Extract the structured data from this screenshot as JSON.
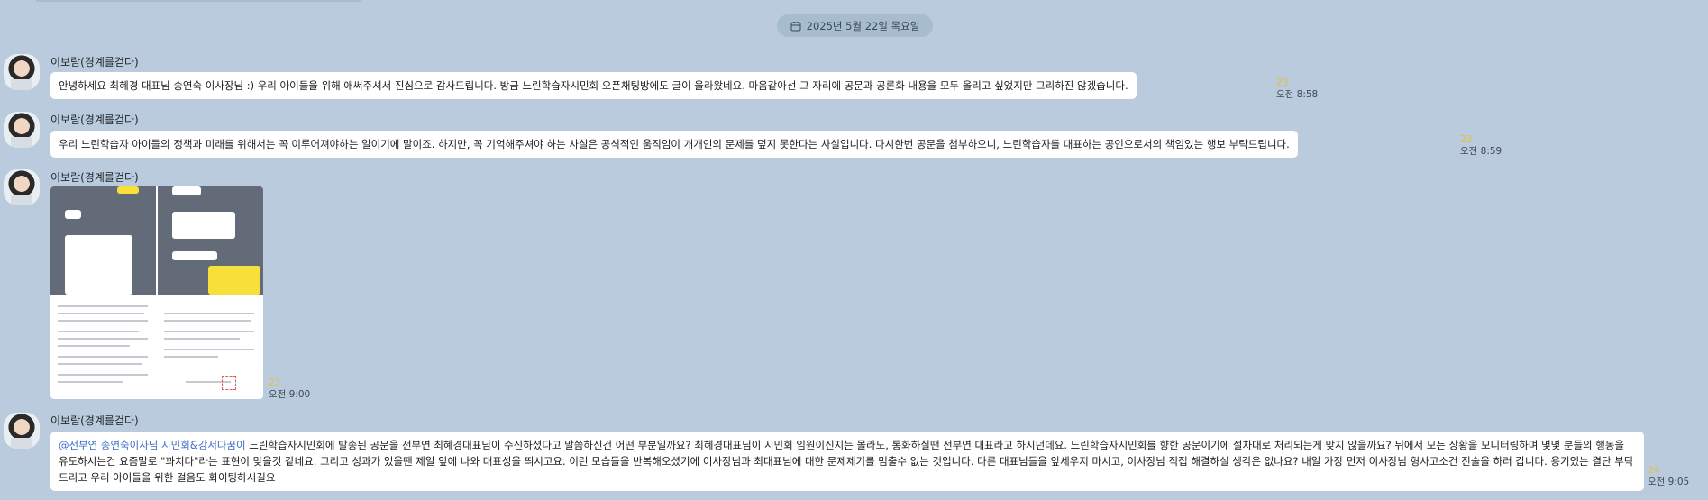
{
  "date_separator": "2025년 5월 22일 목요일",
  "colors": {
    "background": "#b9cbdd",
    "bubble": "#ffffff",
    "unread": "#e2c23a",
    "mention": "#3b6bc4"
  },
  "messages": [
    {
      "sender": "이보람(경계를걷다)",
      "text": "안녕하세요 최혜경 대표님 송연숙 이사장님 :) 우리 아이들을 위해 애써주셔서 진심으로 감사드립니다. 방금 느린학습자시민회 오픈채팅방에도 글이 올라왔네요. 마음같아선 그 자리에 공문과 공론화 내용을 모두 올리고 싶었지만 그리하진 않겠습니다.",
      "unread": "23",
      "time": "오전 8:58"
    },
    {
      "sender": "이보람(경계를걷다)",
      "text": "우리 느린학습자 아이들의 정책과 미래를 위해서는 꼭 이루어져야하는 일이기에 말이죠. 하지만, 꼭 기억해주셔야 하는 사실은 공식적인 움직임이 개개인의 문제를 덮지 못한다는 사실입니다. 다시한번 공문을 첨부하오니, 느린학습자를 대표하는 공인으로서의 책임있는 행보 부탁드립니다.",
      "unread": "23",
      "time": "오전 8:59"
    },
    {
      "sender": "이보람(경계를걷다)",
      "image_alt": "chat-screenshot-and-document-image",
      "unread": "23",
      "time": "오전 9:00"
    },
    {
      "sender": "이보람(경계를걷다)",
      "mention": "@전부연 송연숙이사님 시민회&강서다꿈이",
      "text": " 느린학습자시민회에 발송된 공문을 전부연 최혜경대표님이 수신하셨다고 말씀하신건 어떤 부분일까요? 최혜경대표님이 시민회 임원이신지는 몰라도, 통화하실땐 전부연 대표라고 하시던데요. 느린학습자시민회를 향한 공문이기에 절차대로 처리되는게 맞지 않을까요? 뒤에서 모든 상황을 모니터링하며 몇몇 분들의 행동을 유도하시는건 요즘말로 \"꽈치다\"라는 표현이 맞을것 같네요. 그리고 성과가 있을땐 제일 앞에 나와 대표성을 띄시고요. 이런 모습들을 반복해오셨기에 이사장님과 최대표님에 대한 문제제기를 멈출수 없는 것입니다. 다른 대표님들을 앞세우지 마시고, 이사장님 직접 해결하실 생각은 없나요? 내일 가장 먼저 이사장님 형사고소건 진술을 하러 갑니다. 용기있는 결단 부탁드리고 우리 아이들을 위한 걸음도 화이팅하시길요",
      "unread": "24",
      "time": "오전 9:05"
    }
  ]
}
